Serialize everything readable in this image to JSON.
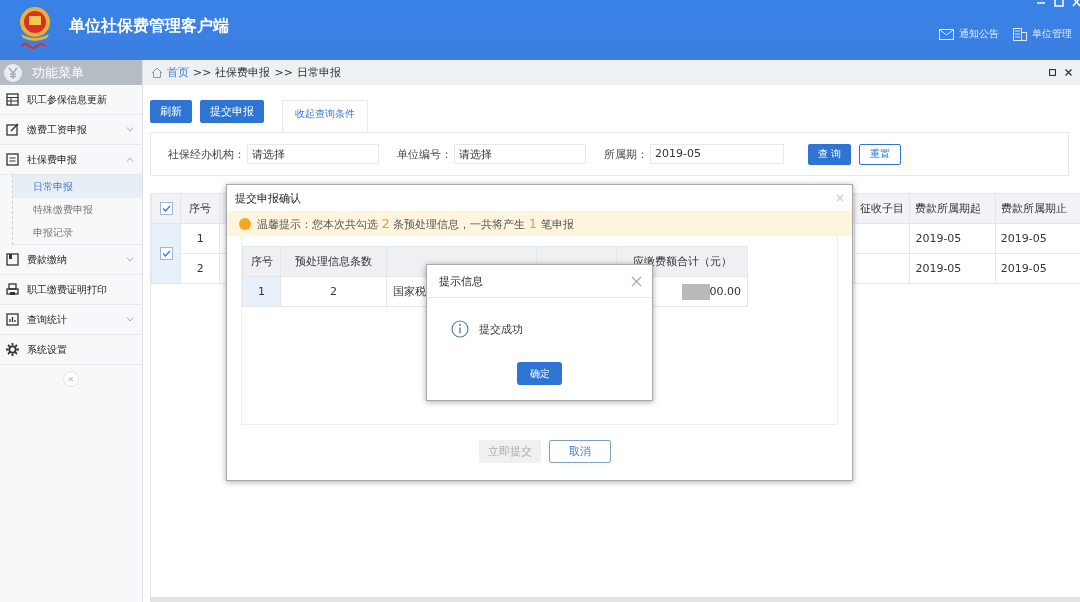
{
  "app": {
    "title": "单位社保费管理客户端"
  },
  "header_links": [
    {
      "label": "通知公告"
    },
    {
      "label": "单位管理"
    }
  ],
  "sidebar": {
    "title": "功能菜单",
    "items": [
      {
        "label": "职工参保信息更新",
        "expandable": false
      },
      {
        "label": "缴费工资申报",
        "expandable": true,
        "expanded": false
      },
      {
        "label": "社保费申报",
        "expandable": true,
        "expanded": true,
        "children": [
          {
            "label": "日常申报",
            "selected": true
          },
          {
            "label": "特殊缴费申报",
            "selected": false
          },
          {
            "label": "申报记录",
            "selected": false
          }
        ]
      },
      {
        "label": "费款缴纳",
        "expandable": true,
        "expanded": false
      },
      {
        "label": "职工缴费证明打印",
        "expandable": false
      },
      {
        "label": "查询统计",
        "expandable": true,
        "expanded": false
      },
      {
        "label": "系统设置",
        "expandable": false
      }
    ],
    "collapse": "«"
  },
  "breadcrumb": [
    {
      "label": "首页",
      "kind": "link"
    },
    {
      "label": ">>",
      "kind": "sep"
    },
    {
      "label": "社保费申报",
      "kind": "text"
    },
    {
      "label": ">>",
      "kind": "sep"
    },
    {
      "label": "日常申报",
      "kind": "text"
    }
  ],
  "toolbar": {
    "buttons": [
      "刷新",
      "提交申报"
    ],
    "tab": "收起查询条件"
  },
  "filters": [
    {
      "label": "社保经办机构：",
      "value": "请选择"
    },
    {
      "label": "单位编号：",
      "value": "请选择"
    },
    {
      "label": "所属期：",
      "value": "2019-05"
    }
  ],
  "filter_buttons": [
    {
      "label": "查 询",
      "kind": "primary"
    },
    {
      "label": "重置",
      "kind": "outline"
    }
  ],
  "table": {
    "all_checked": true,
    "columns": [
      "序号",
      "征收子目",
      "费款所属期起",
      "费款所属期止"
    ],
    "rows": [
      {
        "seq": "1",
        "period_start": "2019-05",
        "period_end": "2019-05"
      },
      {
        "seq": "2",
        "period_start": "2019-05",
        "period_end": "2019-05"
      }
    ],
    "rows_checked": true
  },
  "confirm_dialog": {
    "title": "提交申报确认",
    "notice": "温馨提示：您本次共勾选 **2** 条预处理信息，一共将产生 **1** 笔申报",
    "columns": [
      "序号",
      "预处理信息条数",
      "应缴费额合计（元）"
    ],
    "rows": [
      {
        "seq": "1",
        "count": "2",
        "office": "国家税",
        "amount": "00.00",
        "redacted": true
      }
    ],
    "buttons": [
      {
        "label": "立即提交",
        "disabled": true
      },
      {
        "label": "取消",
        "disabled": false
      }
    ]
  },
  "info_dialog": {
    "title": "提示信息",
    "message": "提交成功",
    "button": "确定"
  }
}
